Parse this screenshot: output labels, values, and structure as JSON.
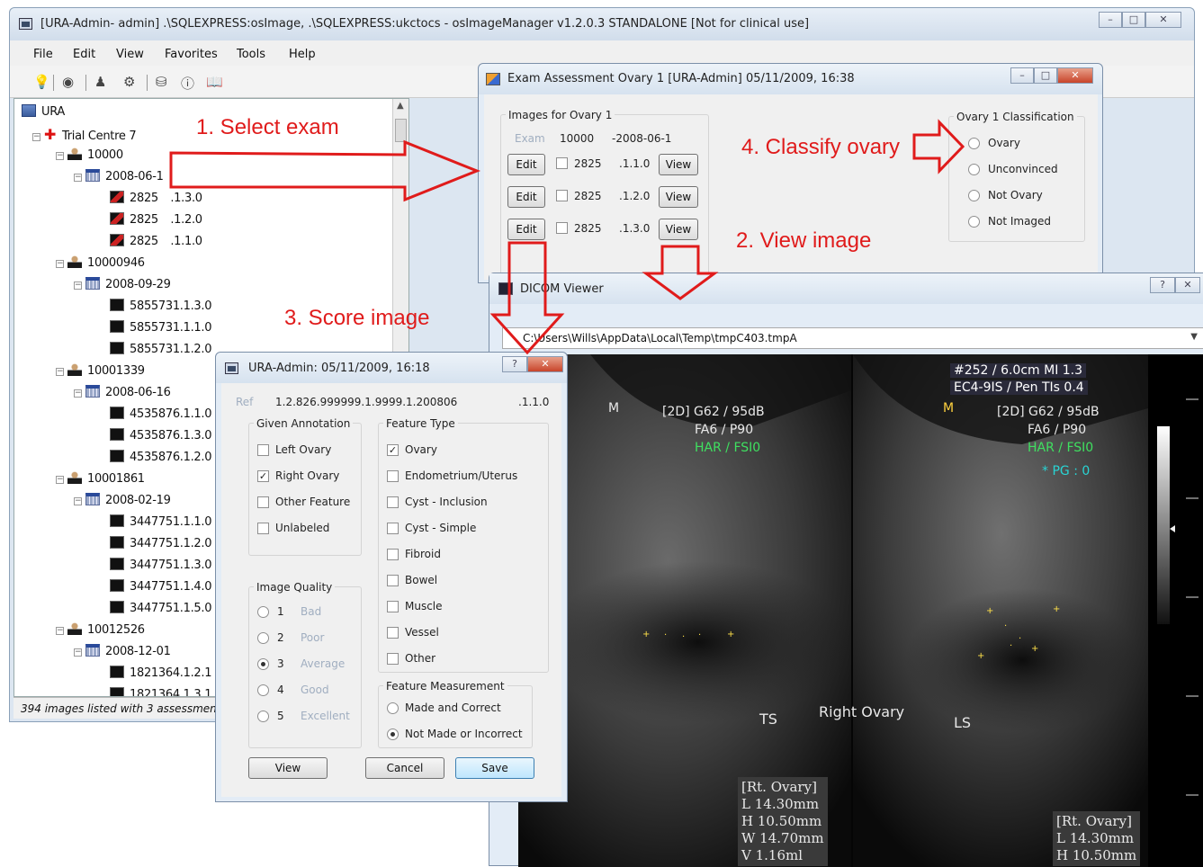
{
  "main_window": {
    "title": "[URA-Admin- admin] .\\SQLEXPRESS:osImage, .\\SQLEXPRESS:ukctocs - osImageManager v1.2.0.3 STANDALONE  [Not for clinical use]",
    "menu": [
      "File",
      "Edit",
      "View",
      "Favorites",
      "Tools",
      "Help"
    ],
    "status": "394 images listed with 3 assessments"
  },
  "tree": {
    "root": "URA",
    "centre": "Trial Centre 7",
    "patients": [
      {
        "id": "10000",
        "date": "2008-06-1",
        "images": [
          [
            "2825",
            ".1.3.0"
          ],
          [
            "2825",
            ".1.2.0"
          ],
          [
            "2825",
            ".1.1.0"
          ]
        ]
      },
      {
        "id": "10000946",
        "date": "2008-09-29",
        "images": [
          [
            "5855731.1.3.0"
          ],
          [
            "5855731.1.1.0"
          ],
          [
            "5855731.1.2.0"
          ]
        ]
      },
      {
        "id": "10001339",
        "date": "2008-06-16",
        "images": [
          [
            "4535876.1.1.0"
          ],
          [
            "4535876.1.3.0"
          ],
          [
            "4535876.1.2.0"
          ]
        ]
      },
      {
        "id": "10001861",
        "date": "2008-02-19",
        "images": [
          [
            "3447751.1.1.0"
          ],
          [
            "3447751.1.2.0"
          ],
          [
            "3447751.1.3.0"
          ],
          [
            "3447751.1.4.0"
          ],
          [
            "3447751.1.5.0"
          ]
        ]
      },
      {
        "id": "10012526",
        "date": "2008-12-01",
        "images": [
          [
            "1821364.1.2.1"
          ],
          [
            "1821364.1.3.1"
          ]
        ]
      }
    ]
  },
  "exam_window": {
    "title": "Exam Assessment Ovary 1 [URA-Admin] 05/11/2009, 16:38",
    "images_group": "Images for Ovary 1",
    "exam_label": "Exam",
    "exam_id": "10000",
    "exam_date": "-2008-06-1",
    "rows": [
      {
        "edit": "Edit",
        "id": "2825",
        "suffix": ".1.3.0",
        "view": "View"
      },
      {
        "edit": "Edit",
        "id": "2825",
        "suffix": ".1.2.0",
        "view": "View"
      },
      {
        "edit": "Edit",
        "id": "2825",
        "suffix": ".1.1.0",
        "view": "View"
      }
    ],
    "classification_group": "Ovary 1 Classification",
    "classification_options": [
      "Ovary",
      "Unconvinced",
      "Not Ovary",
      "Not Imaged"
    ]
  },
  "dicom_viewer": {
    "title": "DICOM Viewer",
    "path": "C:\\Users\\Wills\\AppData\\Local\\Temp\\tmpC403.tmpA",
    "overlay": {
      "top_right_1": "#252    / 6.0cm  MI  1.3",
      "top_right_2": "EC4-9IS /   Pen TIs 0.4",
      "left_m": "M",
      "right_m": "M",
      "left_mode": "[2D] G62 / 95dB",
      "left_fa": "FA6 / P90",
      "left_har": "HAR / FSI0",
      "right_mode": "[2D] G62 / 95dB",
      "right_fa": "FA6 / P90",
      "right_har": "HAR / FSI0",
      "pg": "* PG : 0",
      "ts": "TS",
      "ls": "LS",
      "center_label": "Right Ovary",
      "meas_left": [
        "[Rt. Ovary]",
        "L  14.30mm",
        "H  10.50mm",
        "W  14.70mm",
        "V  1.16ml"
      ],
      "meas_right": [
        "[Rt. Ovary]",
        "L  14.30mm",
        "H  10.50mm"
      ]
    }
  },
  "score_dialog": {
    "title": "URA-Admin: 05/11/2009, 16:18",
    "ref_label": "Ref",
    "ref_value": "1.2.826.999999.1.9999.1.200806",
    "ref_suffix": ".1.1.0",
    "given_annotation_label": "Given Annotation",
    "given_annotation": [
      {
        "label": "Left Ovary",
        "checked": false
      },
      {
        "label": "Right Ovary",
        "checked": true
      },
      {
        "label": "Other Feature",
        "checked": false
      },
      {
        "label": "Unlabeled",
        "checked": false
      }
    ],
    "feature_type_label": "Feature Type",
    "feature_types": [
      {
        "label": "Ovary",
        "checked": true
      },
      {
        "label": "Endometrium/Uterus",
        "checked": false
      },
      {
        "label": "Cyst - Inclusion",
        "checked": false
      },
      {
        "label": "Cyst - Simple",
        "checked": false
      },
      {
        "label": "Fibroid",
        "checked": false
      },
      {
        "label": "Bowel",
        "checked": false
      },
      {
        "label": "Muscle",
        "checked": false
      },
      {
        "label": "Vessel",
        "checked": false
      },
      {
        "label": "Other",
        "checked": false
      }
    ],
    "image_quality_label": "Image Quality",
    "image_quality": [
      {
        "num": "1",
        "label": "Bad",
        "selected": false
      },
      {
        "num": "2",
        "label": "Poor",
        "selected": false
      },
      {
        "num": "3",
        "label": "Average",
        "selected": true
      },
      {
        "num": "4",
        "label": "Good",
        "selected": false
      },
      {
        "num": "5",
        "label": "Excellent",
        "selected": false
      }
    ],
    "feature_measurement_label": "Feature Measurement",
    "feature_measurement": [
      {
        "label": "Made and Correct",
        "selected": false
      },
      {
        "label": "Not Made or Incorrect",
        "selected": true
      }
    ],
    "buttons": {
      "view": "View",
      "cancel": "Cancel",
      "save": "Save"
    }
  },
  "annotations": {
    "step1": "1.  Select exam",
    "step2": "2.  View image",
    "step3": "3. Score image",
    "step4": "4. Classify ovary"
  },
  "colors": {
    "annotation": "#e01b1b",
    "checked_radio": "#333333"
  }
}
